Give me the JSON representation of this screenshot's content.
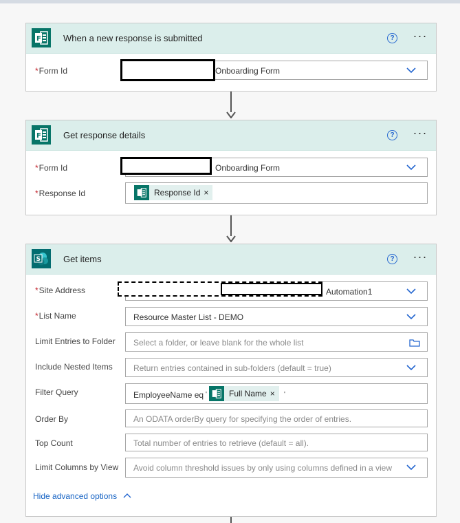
{
  "colors": {
    "accent": "#2567d0",
    "forms_icon": "#077568",
    "sharepoint_icon": "#036c70",
    "header_bg": "#dbeeeb",
    "required": "#c4262e"
  },
  "card1": {
    "title": "When a new response is submitted",
    "icon": "microsoft-forms-icon",
    "form_id": {
      "label": "Form Id",
      "value": "Onboarding Form"
    }
  },
  "card2": {
    "title": "Get response details",
    "icon": "microsoft-forms-icon",
    "form_id": {
      "label": "Form Id",
      "value": "Onboarding Form"
    },
    "response_id": {
      "label": "Response Id",
      "token": "Response Id",
      "token_close": "×"
    }
  },
  "card3": {
    "title": "Get items",
    "icon": "sharepoint-icon",
    "site_address": {
      "label": "Site Address",
      "value": "Automation1"
    },
    "list_name": {
      "label": "List Name",
      "value": "Resource Master List - DEMO"
    },
    "limit_entries": {
      "label": "Limit Entries to Folder",
      "placeholder": "Select a folder, or leave blank for the whole list"
    },
    "include_nested": {
      "label": "Include Nested Items",
      "placeholder": "Return entries contained in sub-folders (default = true)"
    },
    "filter_query": {
      "label": "Filter Query",
      "prefix": "EmployeeName eq",
      "quote_open": "'",
      "token": "Full Name",
      "token_close": "×",
      "quote_close": "'"
    },
    "order_by": {
      "label": "Order By",
      "placeholder": "An ODATA orderBy query for specifying the order of entries."
    },
    "top_count": {
      "label": "Top Count",
      "placeholder": "Total number of entries to retrieve (default = all)."
    },
    "limit_columns": {
      "label": "Limit Columns by View",
      "placeholder": "Avoid column threshold issues by only using columns defined in a view"
    },
    "hide_advanced": "Hide advanced options",
    "hide_advanced_icon": "chevron-up-icon"
  },
  "required_marker": "*",
  "help_glyph": "?",
  "more_glyph": "···"
}
